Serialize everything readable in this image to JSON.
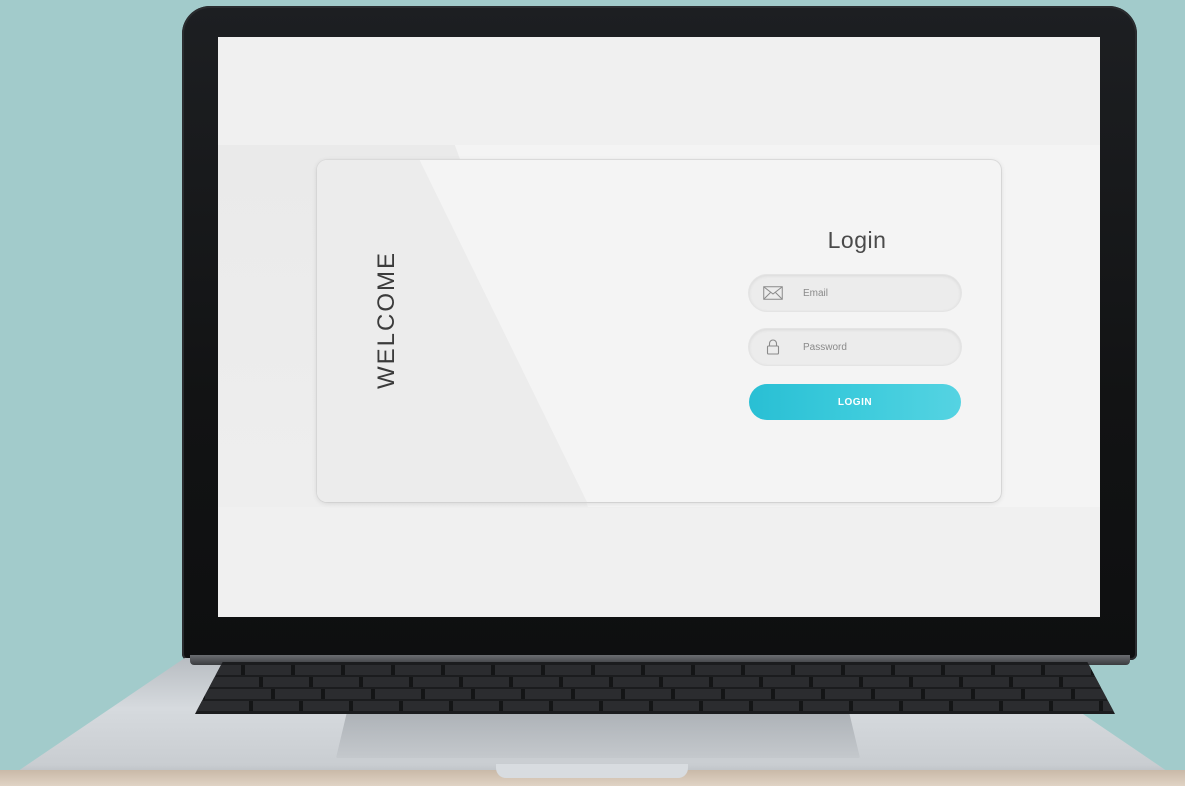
{
  "login_card": {
    "side_label": "WELCOME",
    "title": "Login",
    "email": {
      "placeholder": "Email",
      "icon": "envelope-icon"
    },
    "password": {
      "placeholder": "Password",
      "icon": "lock-icon"
    },
    "submit_label": "LOGIN"
  },
  "colors": {
    "accent": "#33c4d8",
    "background": "#a2cbcb",
    "screen": "#f0f0f0",
    "card": "#f4f4f4",
    "field": "#ececec"
  }
}
